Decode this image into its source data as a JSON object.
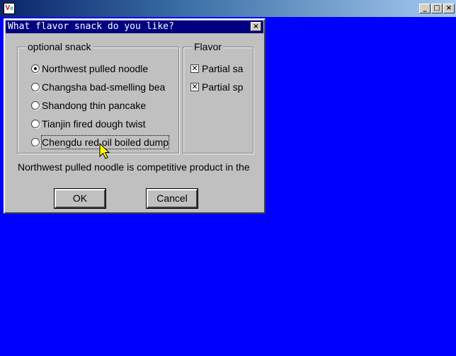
{
  "app_window": {
    "title": "",
    "icon_text": "V",
    "icon_sub": "e",
    "controls": {
      "minimize": "_",
      "maximize": "□",
      "close": "×"
    }
  },
  "dialog": {
    "title": "What flavor snack do you like?",
    "close_glyph": "×",
    "snack_group": {
      "legend": "optional snack",
      "options": [
        {
          "label": "Northwest pulled noodle",
          "selected": true
        },
        {
          "label": "Changsha bad-smelling bea",
          "selected": false
        },
        {
          "label": "Shandong thin pancake",
          "selected": false
        },
        {
          "label": "Tianjin fired dough twist",
          "selected": false
        },
        {
          "label": "Chengdu red oil boiled dump",
          "selected": false,
          "focused": true
        }
      ]
    },
    "flavor_group": {
      "legend": "Flavor",
      "options": [
        {
          "label": "Partial sa",
          "checked": true,
          "mark": "✕"
        },
        {
          "label": "Partial sp",
          "checked": true,
          "mark": "✕"
        }
      ]
    },
    "info_text": "Northwest pulled noodle is competitive product in the",
    "buttons": {
      "ok": "OK",
      "cancel": "Cancel"
    }
  },
  "colors": {
    "desktop": "#0000ff",
    "dialog_title_bar": "#000080",
    "dialog_face": "#c0c0c0",
    "cursor": "#ffff00"
  }
}
